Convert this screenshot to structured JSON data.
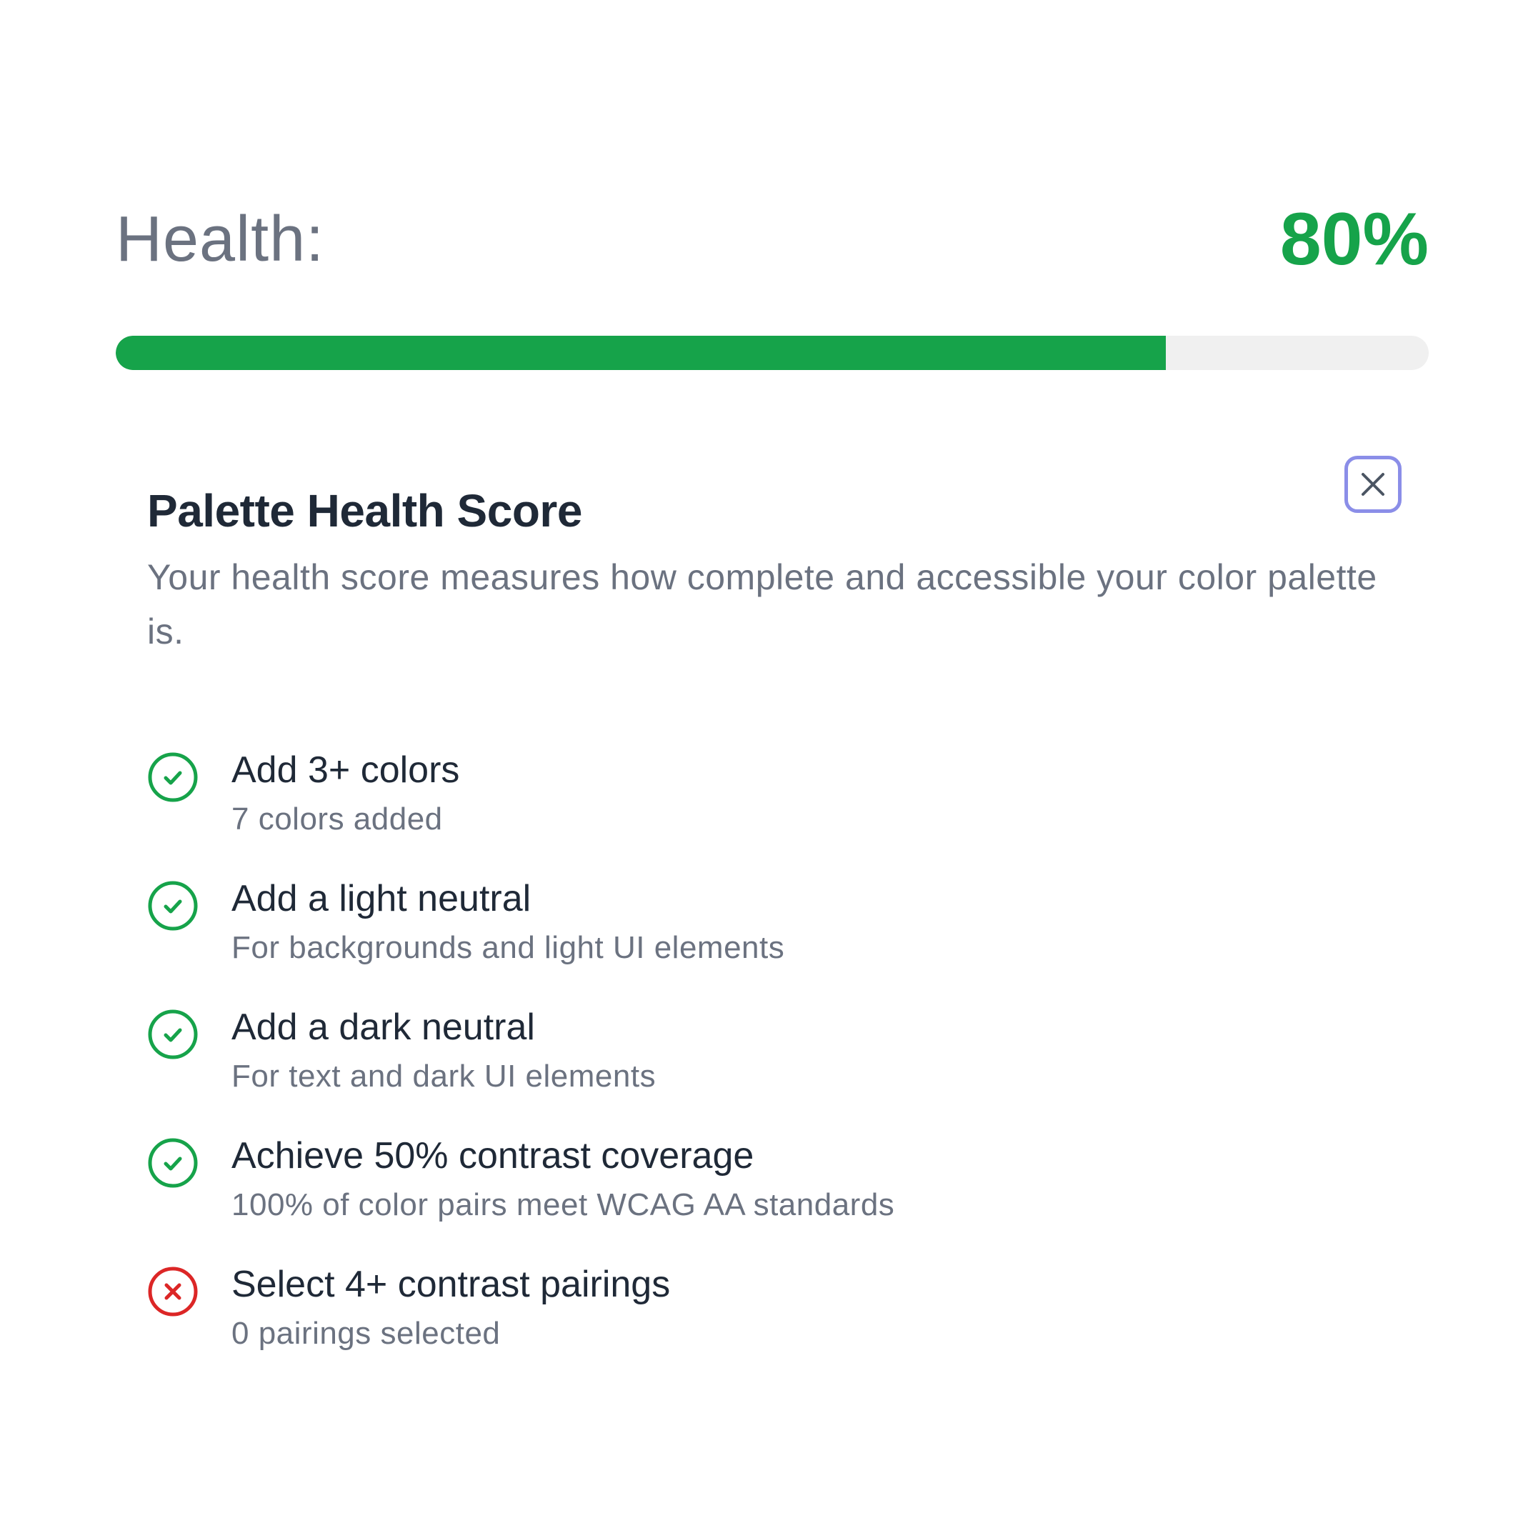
{
  "colors": {
    "success": "#16a34a",
    "error": "#dc2626",
    "focus_ring": "#8b8ee8",
    "track": "#f0f0f0"
  },
  "health": {
    "label": "Health:",
    "value_text": "80%",
    "progress_fraction": 0.8
  },
  "panel": {
    "title": "Palette Health Score",
    "description": "Your health score measures how complete and accessible your color palette is.",
    "close_icon": "close-icon"
  },
  "checklist": [
    {
      "title": "Add 3+ colors",
      "subtitle": "7 colors added",
      "status": "complete",
      "icon": "check-circle-icon"
    },
    {
      "title": "Add a light neutral",
      "subtitle": "For backgrounds and light UI elements",
      "status": "complete",
      "icon": "check-circle-icon"
    },
    {
      "title": "Add a dark neutral",
      "subtitle": "For text and dark UI elements",
      "status": "complete",
      "icon": "check-circle-icon"
    },
    {
      "title": "Achieve 50% contrast coverage",
      "subtitle": "100% of color pairs meet WCAG AA standards",
      "status": "complete",
      "icon": "check-circle-icon"
    },
    {
      "title": "Select 4+ contrast pairings",
      "subtitle": "0 pairings selected",
      "status": "incomplete",
      "icon": "x-circle-icon"
    }
  ]
}
